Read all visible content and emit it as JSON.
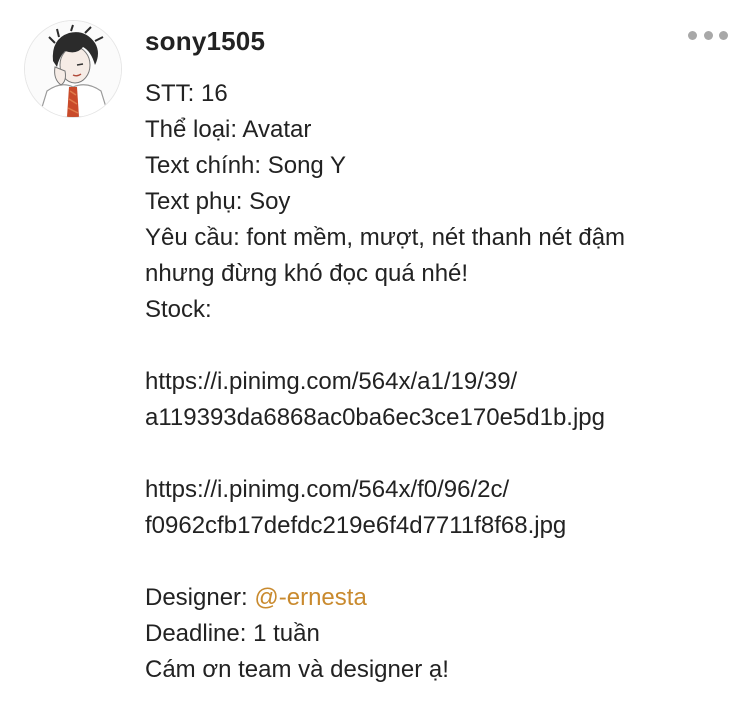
{
  "post": {
    "username": "sony1505",
    "more_icon": "more-horizontal-icon",
    "lines": {
      "stt": "STT: 16",
      "category": "Thể loại: Avatar",
      "main_text": "Text chính: Song Y",
      "sub_text": "Text phụ: Soy",
      "requirement_1": "Yêu cầu: font mềm, mượt, nét thanh nét đậm",
      "requirement_2": "nhưng đừng khó đọc quá nhé!",
      "stock_label": "Stock:",
      "link1_part1": "https://i.pinimg.com/564x/a1/19/39/",
      "link1_part2": "a119393da6868ac0ba6ec3ce170e5d1b.jpg",
      "link2_part1": "https://i.pinimg.com/564x/f0/96/2c/",
      "link2_part2": "f0962cfb17defdc219e6f4d7711f8f68.jpg",
      "designer_label": "Designer: ",
      "designer_mention": "@-ernesta",
      "deadline": "Deadline: 1 tuần",
      "thanks": "Cám ơn team và designer ạ!"
    }
  },
  "colors": {
    "text": "#222222",
    "mention": "#c98a2e",
    "dots": "#a8a8a8"
  }
}
